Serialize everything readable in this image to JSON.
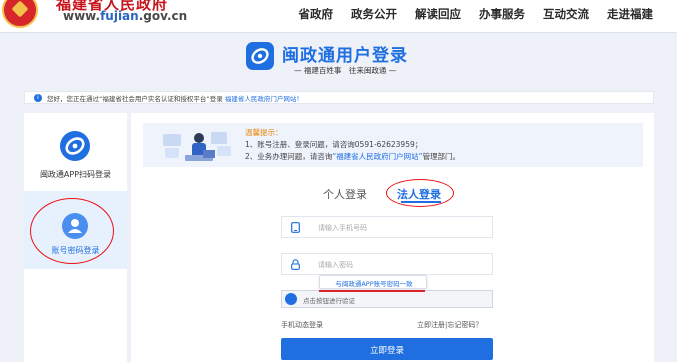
{
  "header": {
    "site_title": "福建省人民政府",
    "url_prefix": "www.",
    "url_highlight": "fujian",
    "url_suffix": ".gov.cn",
    "nav": [
      "省政府",
      "政务公开",
      "解读回应",
      "办事服务",
      "互动交流",
      "走进福建"
    ]
  },
  "banner": {
    "title": "闽政通用户登录",
    "subtitle": "— 福建百姓事　往来闽政通 —"
  },
  "notice": {
    "icon": "info-icon",
    "text": "您好，您正在通过“福建省社会用户实名认证和授权平台”登录",
    "link": "福建省人民政府门户网站！"
  },
  "sidebar": {
    "items": [
      {
        "label": "闽政通APP扫码登录",
        "icon": "app-scan-icon"
      },
      {
        "label": "账号密码登录",
        "icon": "user-icon"
      }
    ]
  },
  "tips": {
    "title": "温馨提示：",
    "line1": "1、账号注册、登录问题，请咨询0591-62623959；",
    "line2_prefix": "2、业务办理问题，请咨询",
    "line2_link": "“福建省人民政府门户网站”",
    "line2_suffix": "管理部门。"
  },
  "tabs": {
    "personal": "个人登录",
    "legal": "法人登录"
  },
  "form": {
    "phone_placeholder": "请输入手机号码",
    "password_placeholder": "请输入密码",
    "tooltip": "与闽政通APP账号密码一致",
    "verify_text": "点击按钮进行验证",
    "sms_login": "手机动态登录",
    "register": "立即注册",
    "separator": "|",
    "forgot": "忘记密码？",
    "submit": "立即登录"
  },
  "colors": {
    "brand": "#1f6fe0",
    "header_red": "#c8161d",
    "annotation_red": "#e11111",
    "tip_orange": "#e8890c"
  }
}
